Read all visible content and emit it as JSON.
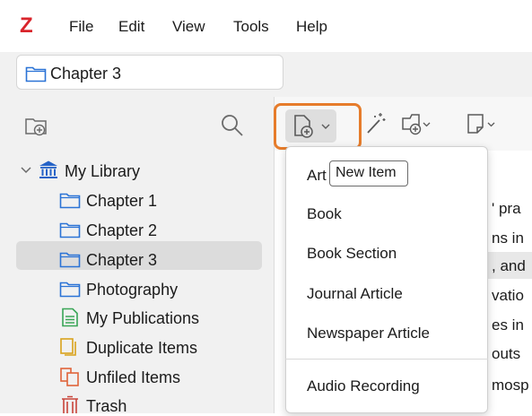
{
  "app": {
    "logo": "Z"
  },
  "menubar": {
    "items": [
      "File",
      "Edit",
      "View",
      "Tools",
      "Help"
    ]
  },
  "tab": {
    "title": "Chapter 3"
  },
  "sidebar": {
    "library_label": "My Library",
    "items": [
      {
        "label": "Chapter 1",
        "icon": "folder-icon"
      },
      {
        "label": "Chapter 2",
        "icon": "folder-icon"
      },
      {
        "label": "Chapter 3",
        "icon": "folder-icon",
        "selected": true
      },
      {
        "label": "Photography",
        "icon": "folder-icon"
      },
      {
        "label": "My Publications",
        "icon": "publications-icon"
      },
      {
        "label": "Duplicate Items",
        "icon": "duplicate-icon"
      },
      {
        "label": "Unfiled Items",
        "icon": "unfiled-icon"
      },
      {
        "label": "Trash",
        "icon": "trash-icon"
      }
    ]
  },
  "tooltip": {
    "text": "New Item"
  },
  "dropdown": {
    "items": [
      "Art",
      "Book",
      "Book Section",
      "Journal Article",
      "Newspaper Article",
      "Audio Recording"
    ]
  },
  "item_pane": {
    "fragments": [
      "' pra",
      "ns in",
      ", and",
      "vatio",
      "es in",
      "outs",
      "mosp"
    ]
  },
  "colors": {
    "accent_orange": "#e67c2b",
    "folder_blue": "#2b73d6",
    "library_blue": "#2563c7",
    "publications_green": "#3aa657",
    "duplicate_yellow": "#d9a21b",
    "unfiled_orange": "#e0643a",
    "trash_red": "#c9453b",
    "logo_red": "#d9242b"
  }
}
